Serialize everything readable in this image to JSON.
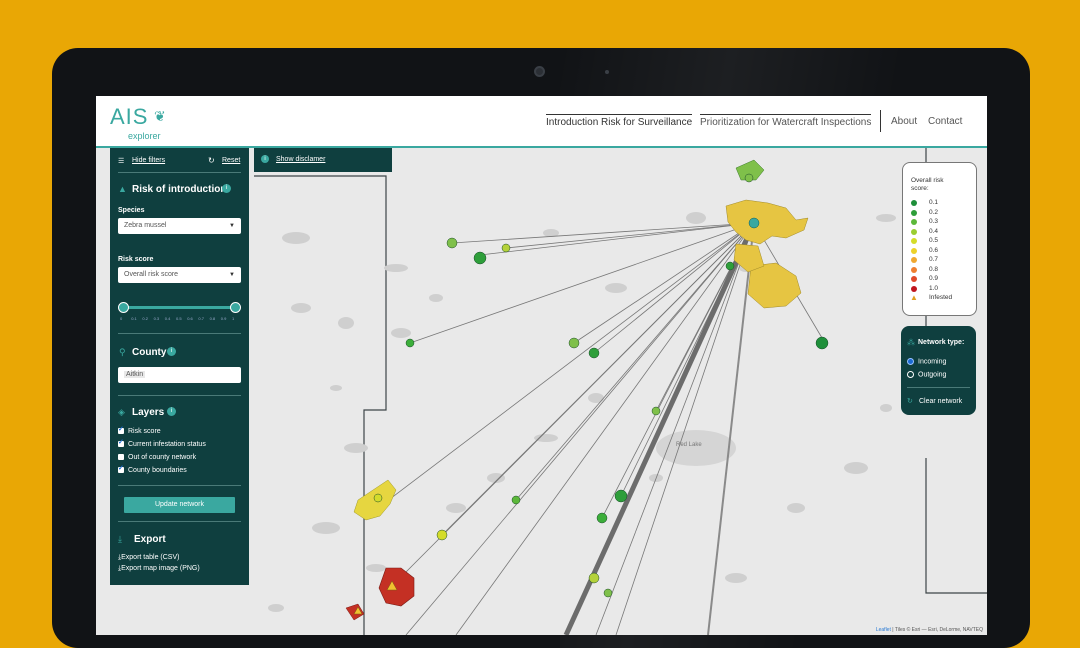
{
  "header": {
    "logo_main": "AIS",
    "logo_sub": "explorer",
    "nav": [
      {
        "label": "Introduction Risk for Surveillance"
      },
      {
        "label": "Prioritization for Watercraft Inspections"
      },
      {
        "label": "About"
      },
      {
        "label": "Contact"
      }
    ]
  },
  "sidebar": {
    "hide_filters": "Hide filters",
    "reset": "Reset",
    "risk_heading": "Risk of introduction",
    "species_label": "Species",
    "species_value": "Zebra mussel",
    "risk_score_label": "Risk score",
    "risk_score_value": "Overall risk score",
    "slider_ticks": [
      "0",
      "0.1",
      "0.2",
      "0.3",
      "0.4",
      "0.5",
      "0.6",
      "0.7",
      "0.8",
      "0.9",
      "1"
    ],
    "slider_range": [
      0,
      1
    ],
    "county_heading": "County",
    "county_value": "Aitkin",
    "layers_heading": "Layers",
    "layers": [
      {
        "label": "Risk score",
        "checked": true
      },
      {
        "label": "Current infestation status",
        "checked": true
      },
      {
        "label": "Out of county network",
        "checked": false
      },
      {
        "label": "County boundaries",
        "checked": true
      }
    ],
    "update_button": "Update network",
    "export_heading": "Export",
    "export_table": "Export table (CSV)",
    "export_image": "Export map image (PNG)"
  },
  "disclaimer": "Show disclamer",
  "legend": {
    "title_line1": "Overall risk",
    "title_line2": "score:",
    "items": [
      {
        "label": "0.1",
        "color": "#1e8f3a"
      },
      {
        "label": "0.2",
        "color": "#2e9e3a"
      },
      {
        "label": "0.3",
        "color": "#5cb83a"
      },
      {
        "label": "0.4",
        "color": "#9acd32"
      },
      {
        "label": "0.5",
        "color": "#d4dc2a"
      },
      {
        "label": "0.6",
        "color": "#ecd22a"
      },
      {
        "label": "0.7",
        "color": "#f0a830"
      },
      {
        "label": "0.8",
        "color": "#ef7f30"
      },
      {
        "label": "0.9",
        "color": "#e04a2a"
      },
      {
        "label": "1.0",
        "color": "#c0161e"
      }
    ],
    "infested_label": "Infested"
  },
  "network": {
    "title": "Network type:",
    "options": [
      {
        "label": "Incoming",
        "selected": true
      },
      {
        "label": "Outgoing",
        "selected": false
      }
    ],
    "clear": "Clear network"
  },
  "map": {
    "lake_label": "Red Lake",
    "attribution_link": "Leaflet",
    "attribution_text": "| Tiles © Esri — Esri, DeLorme, NAVTEQ"
  },
  "colors": {
    "accent": "#3aa8a0",
    "panel": "#0f3f3f"
  }
}
